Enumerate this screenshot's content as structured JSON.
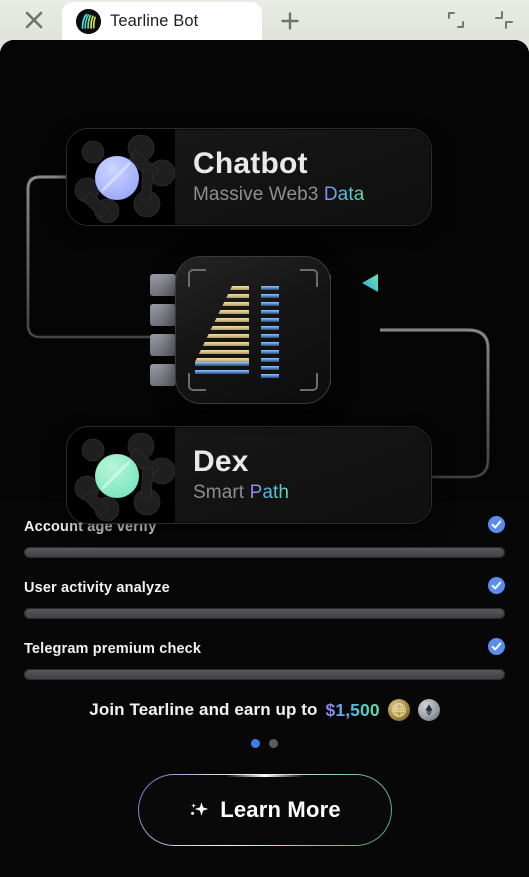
{
  "browser": {
    "close_icon": "close-icon",
    "tab": {
      "title": "Tearline Bot",
      "favicon": "tearline-logo-icon"
    },
    "new_tab_icon": "plus-icon",
    "window_controls": [
      {
        "name": "expand-window-icon"
      },
      {
        "name": "collapse-window-icon"
      }
    ]
  },
  "flow": {
    "cards": [
      {
        "title": "Chatbot",
        "subtitle_plain": "Massive Web3",
        "subtitle_accent": "Data",
        "icon": "network-nodes-blue-sphere-icon"
      },
      {
        "title": "Dex",
        "subtitle_plain": "Smart",
        "subtitle_accent": "Path",
        "icon": "network-nodes-green-sphere-icon"
      }
    ],
    "chip": {
      "label": "AI",
      "icon": "ai-chip-icon"
    },
    "arrow_icon": "play-triangle-icon"
  },
  "tasks": [
    {
      "label": "Account age verify",
      "status_icon": "check-circle-icon",
      "progress": 100
    },
    {
      "label": "User activity analyze",
      "status_icon": "check-circle-icon",
      "progress": 100
    },
    {
      "label": "Telegram premium check",
      "status_icon": "check-circle-icon",
      "progress": 100
    }
  ],
  "promo": {
    "text": "Join Tearline and earn up to",
    "amount": "$1,500",
    "coins": [
      {
        "name": "gold-coin-icon"
      },
      {
        "name": "silver-coin-icon"
      }
    ],
    "dots": [
      {
        "active": true
      },
      {
        "active": false
      }
    ]
  },
  "cta": {
    "label": "Learn More",
    "icon": "sparkle-icon"
  },
  "colors": {
    "accent_blue": "#3d7bf0",
    "check_blue": "#5a8dee",
    "gradient_start": "#9a7ff0",
    "gradient_mid": "#52b9e8",
    "gradient_end": "#62dba4",
    "background": "#070707",
    "chrome": "#e4e8de"
  }
}
